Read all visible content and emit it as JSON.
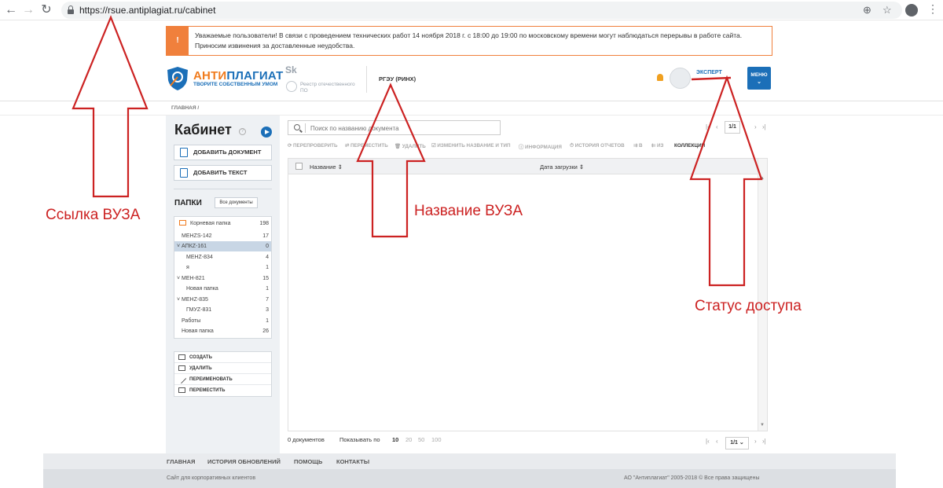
{
  "browser": {
    "url": "https://rsue.antiplagiat.ru/cabinet",
    "back": "←",
    "forward": "→",
    "reload": "↻",
    "zoom_icon": "⊕",
    "star_icon": "☆",
    "menu_icon": "⋮"
  },
  "notice": {
    "icon": "!",
    "text": "Уважаемые пользователи! В связи с проведением технических работ 14 ноября 2018 г. с 18:00 до 19:00 по московскому времени могут наблюдаться перерывы в работе сайта. Приносим извинения за доставленные неудобства."
  },
  "header": {
    "logo_part1": "АНТИ",
    "logo_part2": "ПЛАГИАТ",
    "logo_tagline": "ТВОРИТЕ СОБСТВЕННЫМ УМОМ",
    "sk_mark": "Sk",
    "reestr": "Реестр отечественного ПО",
    "university": "РГЭУ (РИНХ)",
    "user_role": "ЭКСПЕРТ",
    "menu_label": "МЕНЮ",
    "menu_chev": "⌄",
    "brand_blue": "#1b6fb8",
    "brand_orange": "#f07b1d"
  },
  "breadcrumb": "ГЛАВНАЯ /",
  "sidebar": {
    "title": "Кабинет",
    "help": "?",
    "add_document": "ДОБАВИТЬ ДОКУМЕНТ",
    "add_text": "ДОБАВИТЬ ТЕКСТ",
    "folders_title": "ПАПКИ",
    "all_docs": "Все документы",
    "folders": [
      {
        "name": "Корневая папка",
        "count": "198"
      },
      {
        "name": "MEHZS-142",
        "count": "17"
      },
      {
        "name": "˅ АПКZ-161",
        "count": "0"
      },
      {
        "name": "MEHZ-834",
        "count": "4"
      },
      {
        "name": "я",
        "count": "1"
      },
      {
        "name": "˅ MEH-821",
        "count": "15"
      },
      {
        "name": "Новая папка",
        "count": "1"
      },
      {
        "name": "˅ MEHZ-835",
        "count": "7"
      },
      {
        "name": "ГМУZ-831",
        "count": "3"
      },
      {
        "name": "Работы",
        "count": "1"
      },
      {
        "name": "Новая папка",
        "count": "26"
      }
    ],
    "actions": [
      "СОЗДАТЬ",
      "УДАЛИТЬ",
      "ПЕРЕИМЕНОВАТЬ",
      "ПЕРЕМЕСТИТЬ"
    ]
  },
  "main": {
    "search_placeholder": "Поиск по названию документа",
    "pager_first": "|‹",
    "pager_prev": "‹",
    "pager_next": "›",
    "pager_last": "›|",
    "page_value": "1/1",
    "page_value_select": "1/1 ⌄",
    "toolbar": [
      "ПЕРЕПРОВЕРИТЬ",
      "ПЕРЕМЕСТИТЬ",
      "УДАЛИТЬ",
      "ИЗМЕНИТЬ НАЗВАНИЕ И ТИП",
      "ИНФОРМАЦИЯ",
      "ИСТОРИЯ ОТЧЕТОВ",
      "В",
      "ИЗ",
      "КОЛЛЕКЦИИ"
    ],
    "col_name": "Название ⇕",
    "col_date": "Дата загрузки ⇕",
    "scroll_up": "▲",
    "scroll_down": "▼",
    "doc_count": "0 документов",
    "show_by": "Показывать по",
    "page_sizes": [
      "10",
      "20",
      "50",
      "100"
    ]
  },
  "footer": {
    "links": [
      "ГЛАВНАЯ",
      "ИСТОРИЯ ОБНОВЛЕНИЙ",
      "ПОМОЩЬ",
      "КОНТАКТЫ"
    ],
    "left_text": "Сайт для корпоративных клиентов",
    "copyright": "АО \"Антиплагиат\" 2005-2018 © Все права защищены"
  },
  "annotations": {
    "label_left": "Ссылка ВУЗА",
    "label_middle": "Название ВУЗА",
    "label_right": "Статус доступа",
    "arrow_color": "#cc2222"
  }
}
